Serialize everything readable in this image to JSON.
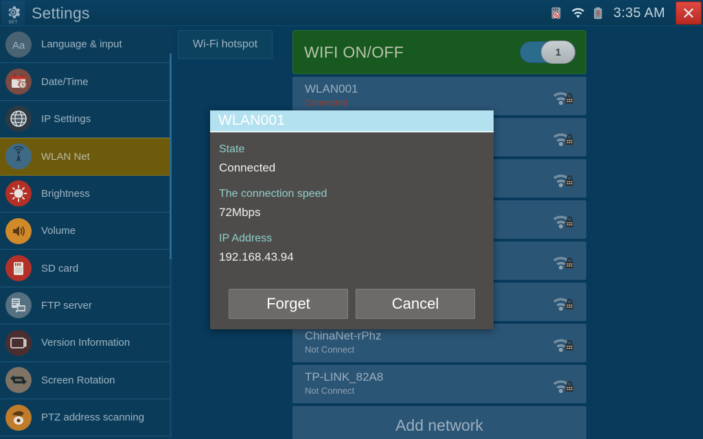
{
  "topbar": {
    "app_icon": "gear-icon",
    "app_icon_sublabel": "SET",
    "title": "Settings",
    "status_icons": [
      "sd-card-disabled-icon",
      "wifi-signal-icon",
      "battery-charging-icon"
    ],
    "clock": "3:35 AM",
    "close_label": "close-icon"
  },
  "sidebar": {
    "items": [
      {
        "label": "Language & input",
        "icon": "language-icon",
        "active": false
      },
      {
        "label": "Date/Time",
        "icon": "calendar-clock-icon",
        "active": false
      },
      {
        "label": "IP Settings",
        "icon": "globe-icon",
        "active": false
      },
      {
        "label": "WLAN Net",
        "icon": "antenna-icon",
        "active": true
      },
      {
        "label": "Brightness",
        "icon": "brightness-icon",
        "active": false
      },
      {
        "label": "Volume",
        "icon": "volume-icon",
        "active": false
      },
      {
        "label": "SD card",
        "icon": "sd-card-icon",
        "active": false
      },
      {
        "label": "FTP server",
        "icon": "ftp-server-icon",
        "active": false
      },
      {
        "label": "Version Information",
        "icon": "monitor-icon",
        "active": false
      },
      {
        "label": "Screen Rotation",
        "icon": "rotate-icon",
        "active": false
      },
      {
        "label": "PTZ address scanning",
        "icon": "ptz-camera-icon",
        "active": false
      }
    ]
  },
  "main": {
    "hotspot_tab": "Wi-Fi hotspot",
    "wifi_toggle": {
      "label": "WIFI ON/OFF",
      "state": "on",
      "knob_glyph": "1"
    },
    "networks": [
      {
        "ssid": "WLAN001",
        "state": "Connected",
        "connected": true,
        "secured": true
      },
      {
        "ssid": "",
        "state": "",
        "connected": false,
        "secured": true
      },
      {
        "ssid": "",
        "state": "",
        "connected": false,
        "secured": true
      },
      {
        "ssid": "",
        "state": "",
        "connected": false,
        "secured": true
      },
      {
        "ssid": "",
        "state": "",
        "connected": false,
        "secured": true
      },
      {
        "ssid": "",
        "state": "",
        "connected": false,
        "secured": true
      },
      {
        "ssid": "ChinaNet-rPhz",
        "state": "Not Connect",
        "connected": false,
        "secured": true
      },
      {
        "ssid": "TP-LINK_82A8",
        "state": "Not Connect",
        "connected": false,
        "secured": true
      }
    ],
    "add_network": "Add network"
  },
  "dialog": {
    "title": "WLAN001",
    "fields": [
      {
        "key": "State",
        "value": "Connected"
      },
      {
        "key": "The connection speed",
        "value": "72Mbps"
      },
      {
        "key": "IP Address",
        "value": "192.168.43.94"
      }
    ],
    "forget_label": "Forget",
    "cancel_label": "Cancel"
  },
  "colors": {
    "background": "#073a5b",
    "sidebar": "#0a3c5a",
    "active_item": "#6d5b0b",
    "wifi_on_bar": "#18591f",
    "wifi_row": "#2b5575",
    "dialog_body": "#4e4c4a",
    "dialog_title_bar": "#b4e1f0",
    "dialog_key": "#8fd0cc",
    "connected_text": "#9c3d2e",
    "close_button": "#c63228"
  }
}
